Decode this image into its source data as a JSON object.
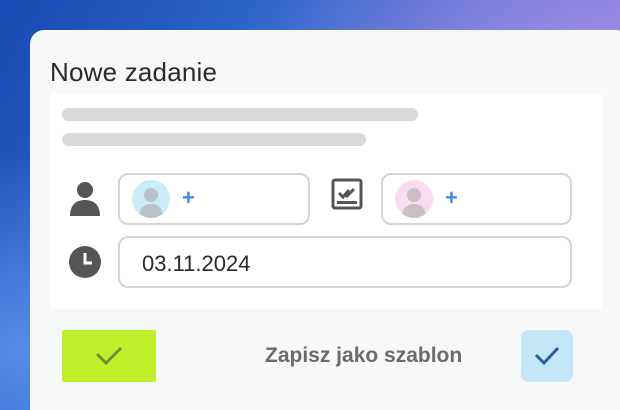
{
  "dialog": {
    "title": "Nowe zadanie"
  },
  "assignees": {
    "responsible_add": "+",
    "verifier_add": "+"
  },
  "due_date": {
    "value": "03.11.2024"
  },
  "footer": {
    "save_template_label": "Zapisz jako szablon",
    "save_template_checked": true
  },
  "colors": {
    "confirm_button": "#bff02a",
    "checkbox_bg": "#c3e7f7",
    "accent_plus": "#3c8fe0"
  },
  "icons": {
    "person": "person-icon",
    "verify": "checkmark-document-icon",
    "clock": "clock-icon",
    "confirm": "checkmark-icon"
  }
}
